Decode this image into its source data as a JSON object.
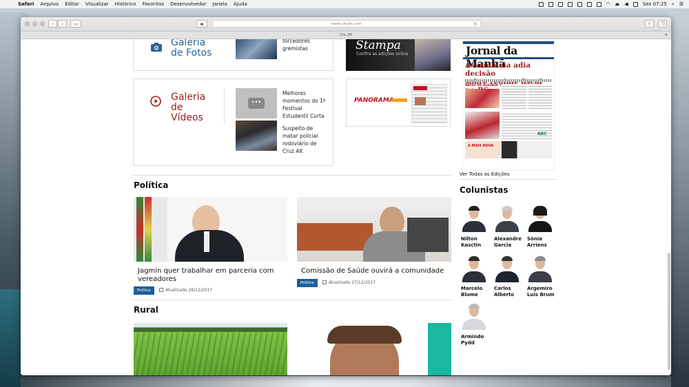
{
  "menubar": {
    "app": "Safari",
    "items": [
      "Arquivo",
      "Editar",
      "Visualizar",
      "Histórico",
      "Favoritos",
      "Desenvolvedor",
      "Janela",
      "Ajuda"
    ],
    "clock": "Sex 07:25"
  },
  "browser": {
    "url": "www.clicjm.com",
    "tab_title": "Clic JM"
  },
  "galleries": {
    "fotos": {
      "title_line1": "Galeria",
      "title_line2": "de Fotos",
      "items": [
        "torcedores",
        "gremistas"
      ]
    },
    "videos": {
      "title_line1": "Galeria",
      "title_line2": "de",
      "title_line3": "Vídeos",
      "items": [
        {
          "lines": [
            "Melhores",
            "momentos do 1º",
            "Festival",
            "Estudantil Curta"
          ]
        },
        {
          "lines": [
            "Suspeito de",
            "matar policial",
            "rodoviário de",
            "Cruz Alt"
          ]
        }
      ]
    }
  },
  "ads": {
    "stampa": {
      "title": "Stampa",
      "subtitle": "Confira as edições online"
    },
    "panorama": {
      "title": "PANORAMA"
    }
  },
  "newspaper": {
    "title": "Jornal da Manhã",
    "headline_line1": "Assembleia adia decisão",
    "headline_line2": "sobre regime fiscal no RS",
    "natal": "NATAL DE ALEGRIA",
    "promo": "A MAIS NOVA",
    "link": "Ver Todas as Edições"
  },
  "sections": {
    "politica": {
      "title": "Política",
      "articles": [
        {
          "title_line1": "Jagmin quer trabalhar em parceria com",
          "title_line2": "vereadores",
          "tag": "Política",
          "date": "Atualizado 28/12/2017"
        },
        {
          "title_line1": "Comissão de Saúde ouvirá a comunidade",
          "title_line2": "",
          "tag": "Política",
          "date": "Atualizado 27/12/2017"
        }
      ]
    },
    "rural": {
      "title": "Rural"
    }
  },
  "colunistas": {
    "title": "Colunistas",
    "people": [
      {
        "first": "Nilton",
        "last": "Kasctin"
      },
      {
        "first": "Alexandre",
        "last": "Garcia"
      },
      {
        "first": "Sônia",
        "last": "Arriens"
      },
      {
        "first": "Marcelo",
        "last": "Blume"
      },
      {
        "first": "Carlos",
        "last": "Alberto"
      },
      {
        "first": "Argemiro",
        "last": "Luís Brum"
      },
      {
        "first": "Armindo",
        "last": "Pydd"
      }
    ]
  },
  "colors": {
    "accent_blue": "#2a6496",
    "accent_red": "#9b1b1b",
    "tag_blue": "#1f5f98"
  }
}
